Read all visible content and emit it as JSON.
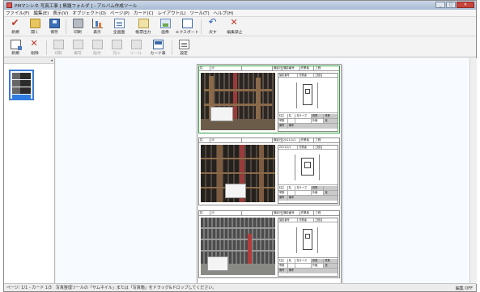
{
  "window": {
    "title": "PMマンシネ 写真工事 [ 無題フォルダ ] - アルバム作成ツール",
    "controls": {
      "minimize": "_",
      "maximize": "□",
      "close": "✕"
    }
  },
  "menubar": [
    "ファイル(F)",
    "編集(E)",
    "表示(V)",
    "オブジェクト(O)",
    "ページ(P)",
    "カード(C)",
    "レイアウト(L)",
    "ツール(T)",
    "ヘルプ(H)"
  ],
  "toolbar1": [
    {
      "label": "新規",
      "icon": "check-icon"
    },
    {
      "label": "開く",
      "icon": "open-folder-icon"
    },
    {
      "label": "保存",
      "icon": "save-icon"
    },
    {
      "label": "印刷",
      "icon": "print-icon"
    },
    {
      "label": "表示",
      "icon": "chart-icon"
    },
    {
      "label": "全画面",
      "icon": "document-icon"
    },
    {
      "label": "帳票出力",
      "icon": "folder-doc-icon"
    },
    {
      "label": "画像",
      "icon": "photo-icon"
    },
    {
      "label": "エクスポート",
      "icon": "screen-icon"
    },
    {
      "label": "戻す",
      "icon": "undo-icon"
    },
    {
      "label": "編集禁止",
      "icon": "cross-icon"
    }
  ],
  "toolbar2": [
    {
      "label": "新規",
      "icon": "new-card-icon",
      "enabled": true
    },
    {
      "label": "削除",
      "icon": "delete-icon",
      "enabled": true
    },
    {
      "label": "切取",
      "icon": "cut-icon",
      "enabled": false
    },
    {
      "label": "複写",
      "icon": "copy-icon",
      "enabled": false
    },
    {
      "label": "貼付",
      "icon": "paste-icon",
      "enabled": false
    },
    {
      "label": "元に",
      "icon": "restore-icon",
      "enabled": false
    },
    {
      "label": "ツール",
      "icon": "tool-icon",
      "enabled": false
    },
    {
      "label": "カード表",
      "icon": "card-table-icon",
      "enabled": true
    },
    {
      "label": "設定",
      "icon": "settings-icon",
      "enabled": true
    }
  ],
  "sidebar": {
    "header_arrow": "◂"
  },
  "page": {
    "cards": [
      {
        "head": [
          "柱",
          "1F",
          "",
          "撮影日",
          "撮影番号",
          "作業者",
          "工程"
        ],
        "sheet_top": [
          "撮影番号",
          "作業者",
          "工程名"
        ],
        "sheet_bottom": [
          [
            "柱主",
            "柱",
            "柱サイズ",
            "鉄筋",
            "鉄筋"
          ],
          [
            "帯筋",
            "",
            "",
            "外観",
            "良"
          ],
          [
            "備考",
            "備考",
            "",
            "",
            ""
          ]
        ]
      },
      {
        "head": [
          "柱",
          "1F",
          "",
          "撮影日",
          "2011/1/1",
          "作業者",
          "工程"
        ],
        "sheet_top": [
          "2011/1/1",
          "作業者",
          "工程名"
        ],
        "sheet_bottom": [
          [
            "柱主",
            "柱",
            "柱サイズ",
            "鉄筋",
            ""
          ],
          [
            "帯筋",
            "",
            "",
            "外観",
            "良"
          ],
          [
            "備考",
            "備考",
            "",
            "",
            ""
          ]
        ]
      },
      {
        "head": [
          "柱",
          "1F",
          "",
          "撮影日",
          "撮影番号",
          "作業者",
          "工程"
        ],
        "sheet_top": [
          "撮影番号",
          "作業者",
          "工程名"
        ],
        "sheet_bottom": [
          [
            "柱主",
            "柱",
            "柱サイズ",
            "鉄筋",
            "鉄筋"
          ],
          [
            "帯筋",
            "",
            "",
            "外観",
            "良"
          ],
          [
            "備考",
            "備考",
            "",
            "",
            ""
          ]
        ]
      }
    ]
  },
  "statusbar": {
    "text": "ページ: 1/1 - カード 1/3　写真整理ツールの「サムネイル」または「写真箱」をドラッグ&ドロップしてください。",
    "right": "編集 OFF"
  }
}
